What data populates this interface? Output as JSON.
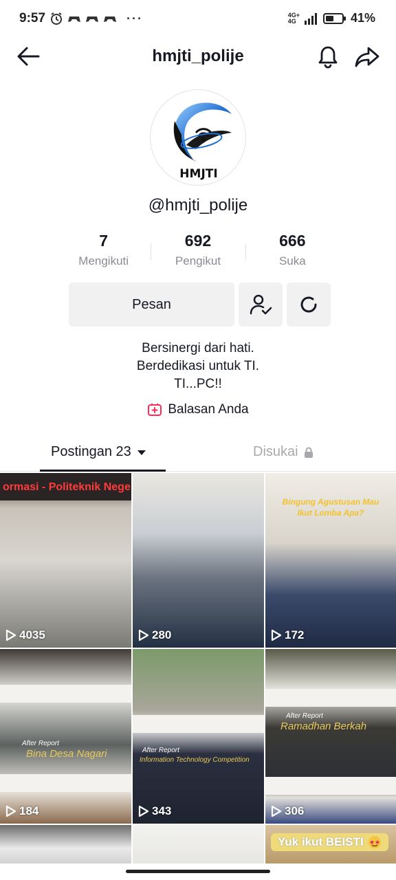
{
  "status_bar": {
    "time": "9:57",
    "network_top": "4G+",
    "network_bottom": "4G",
    "battery": "41%",
    "more": "···"
  },
  "header": {
    "title": "hmjti_polije"
  },
  "profile": {
    "username": "@hmjti_polije",
    "avatar_text": "HMJTI",
    "stats": [
      {
        "value": "7",
        "label": "Mengikuti"
      },
      {
        "value": "692",
        "label": "Pengikut"
      },
      {
        "value": "666",
        "label": "Suka"
      }
    ],
    "message_button": "Pesan",
    "bio": [
      "Bersinergi dari hati.",
      "Berdedikasi untuk TI.",
      "TI...PC!!"
    ],
    "reply_link": "Balasan Anda"
  },
  "tabs": {
    "posts": "Postingan 23",
    "liked": "Disukai"
  },
  "videos": [
    {
      "views": "4035",
      "overlay": "ormasi - Politeknik Negeri"
    },
    {
      "views": "280"
    },
    {
      "views": "172",
      "overlay": "Bingung Agustusan Mau Ikut Lomba Apa?"
    },
    {
      "views": "184",
      "after": "After Report",
      "title": "Bina Desa Nagari"
    },
    {
      "views": "343",
      "after": "After Report",
      "title": "Information Technology Competition"
    },
    {
      "views": "306",
      "after": "After Report",
      "title": "Ramadhan Berkah"
    },
    {},
    {},
    {
      "overlay": "Yuk ikut BEISTI"
    }
  ],
  "colors": {
    "text": "#161823",
    "muted": "#8a8b91",
    "button_bg": "#f1f1f2",
    "accent": "#fe2c55"
  }
}
